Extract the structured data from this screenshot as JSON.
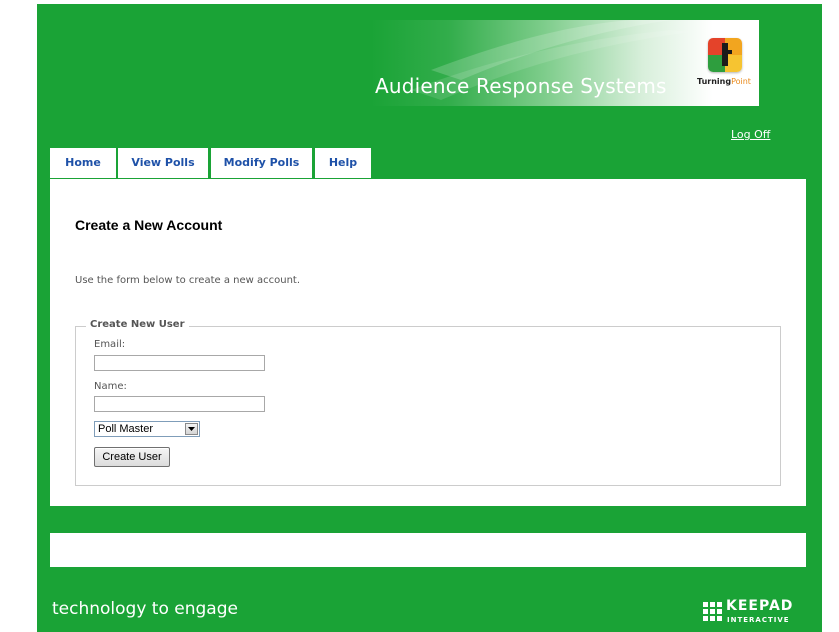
{
  "banner": {
    "title": "Audience Response Systems",
    "logo_brand_bold": "Turning",
    "logo_brand_light": "Point"
  },
  "header": {
    "logoff_label": "Log Off"
  },
  "tabs": [
    {
      "label": "Home"
    },
    {
      "label": "View Polls"
    },
    {
      "label": "Modify Polls"
    },
    {
      "label": "Help"
    }
  ],
  "main": {
    "title": "Create a New Account",
    "intro": "Use the form below to create a new account.",
    "form": {
      "legend": "Create New User",
      "email_label": "Email:",
      "email_value": "",
      "name_label": "Name:",
      "name_value": "",
      "role_selected": "Poll Master",
      "submit_label": "Create User"
    }
  },
  "footer": {
    "tagline": "technology to engage",
    "company_name": "KEEPAD",
    "company_sub": "INTERACTIVE"
  },
  "colors": {
    "brand_green": "#1aa336",
    "tab_text_blue": "#1e51a8",
    "logo_orange": "#e98a1c"
  }
}
